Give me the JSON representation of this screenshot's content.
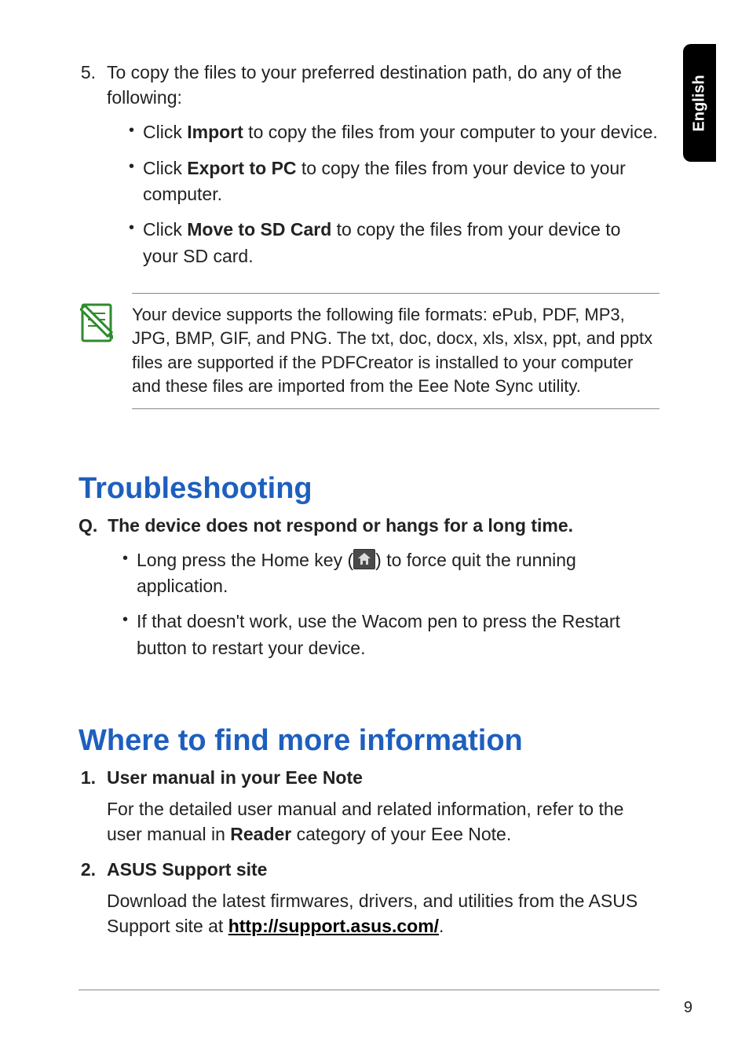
{
  "language_tab": "English",
  "step5": {
    "num": "5.",
    "intro": "To copy the files to your preferred destination path, do any of the following:",
    "bullets": {
      "b1_pre": "Click ",
      "b1_bold": "Import",
      "b1_post": " to copy the files from your computer to your device.",
      "b2_pre": "Click ",
      "b2_bold": "Export to PC",
      "b2_post": " to copy the files from your device to your computer.",
      "b3_pre": "Click ",
      "b3_bold": "Move to SD Card",
      "b3_post": " to copy the files from your device to your SD card."
    }
  },
  "note": "Your device supports the following file formats: ePub, PDF, MP3, JPG, BMP, GIF, and PNG. The txt, doc, docx, xls, xlsx, ppt, and pptx files are supported if the PDFCreator is installed to your computer and these files are imported from the Eee Note Sync utility.",
  "troubleshooting": {
    "heading": "Troubleshooting",
    "q_label": "Q.",
    "q_text": "The device does not respond or hangs for a long time.",
    "a1_pre": "Long press the Home key (",
    "a1_post": ") to force quit the running application.",
    "a2": "If that doesn't work, use the Wacom pen to press the Restart button to restart your device."
  },
  "moreinfo": {
    "heading": "Where to find more information",
    "item1_num": "1.",
    "item1_title": "User manual in your Eee Note",
    "item1_body_pre": "For the detailed user manual and related information, refer to the user manual in ",
    "item1_body_bold": "Reader",
    "item1_body_post": " category of your Eee Note.",
    "item2_num": "2.",
    "item2_title": "ASUS Support site",
    "item2_body_pre": "Download the latest firmwares, drivers, and utilities from the ASUS Support site at ",
    "item2_link": "http://support.asus.com/",
    "item2_body_post": "."
  },
  "page_number": "9"
}
